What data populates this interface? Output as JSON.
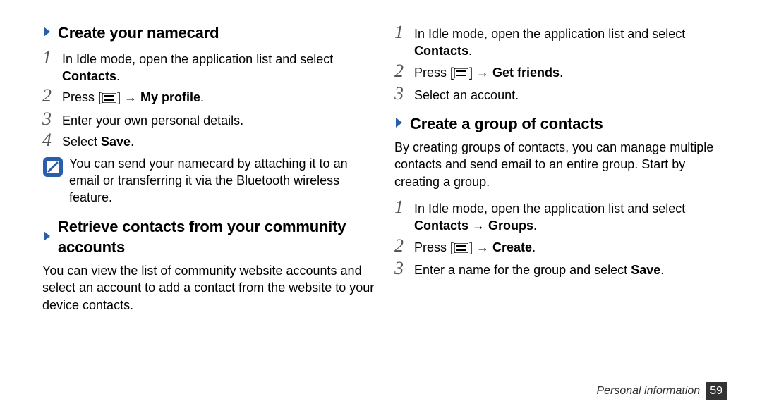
{
  "left": {
    "section_a": {
      "heading": "Create your namecard",
      "steps": [
        {
          "num": "1",
          "pre": "In Idle mode, open the application list and select ",
          "bold": "Contacts",
          "post": "."
        },
        {
          "num": "2",
          "pre": "Press [",
          "post_icon": "] → ",
          "bold": "My profile",
          "tail": "."
        },
        {
          "num": "3",
          "text": "Enter your own personal details."
        },
        {
          "num": "4",
          "pre": "Select ",
          "bold": "Save",
          "post": "."
        }
      ],
      "note": "You can send your namecard by attaching it to an email or transferring it via the Bluetooth wireless feature."
    },
    "section_b": {
      "heading": "Retrieve contacts from your community accounts",
      "para": "You can view the list of community website accounts and select an account to add a contact from the website to your device contacts."
    }
  },
  "right": {
    "steps_top": [
      {
        "num": "1",
        "pre": "In Idle mode, open the application list and select ",
        "bold": "Contacts",
        "post": "."
      },
      {
        "num": "2",
        "pre": "Press [",
        "post_icon": "] → ",
        "bold": "Get friends",
        "tail": "."
      },
      {
        "num": "3",
        "text": "Select an account."
      }
    ],
    "section_c": {
      "heading": "Create a group of contacts",
      "para": "By creating groups of contacts, you can manage multiple contacts and send email to an entire group. Start by creating a group.",
      "steps": [
        {
          "num": "1",
          "pre": "In Idle mode, open the application list and select ",
          "bold": "Contacts → Groups",
          "post": "."
        },
        {
          "num": "2",
          "pre": "Press [",
          "post_icon": "] → ",
          "bold": "Create",
          "tail": "."
        },
        {
          "num": "3",
          "pre": "Enter a name for the group and select ",
          "bold": "Save",
          "post": "."
        }
      ]
    }
  },
  "footer": {
    "label": "Personal information",
    "page": "59"
  },
  "icons": {
    "menu": "menu-icon",
    "note": "note-icon",
    "chevron": "chevron-right-icon"
  }
}
